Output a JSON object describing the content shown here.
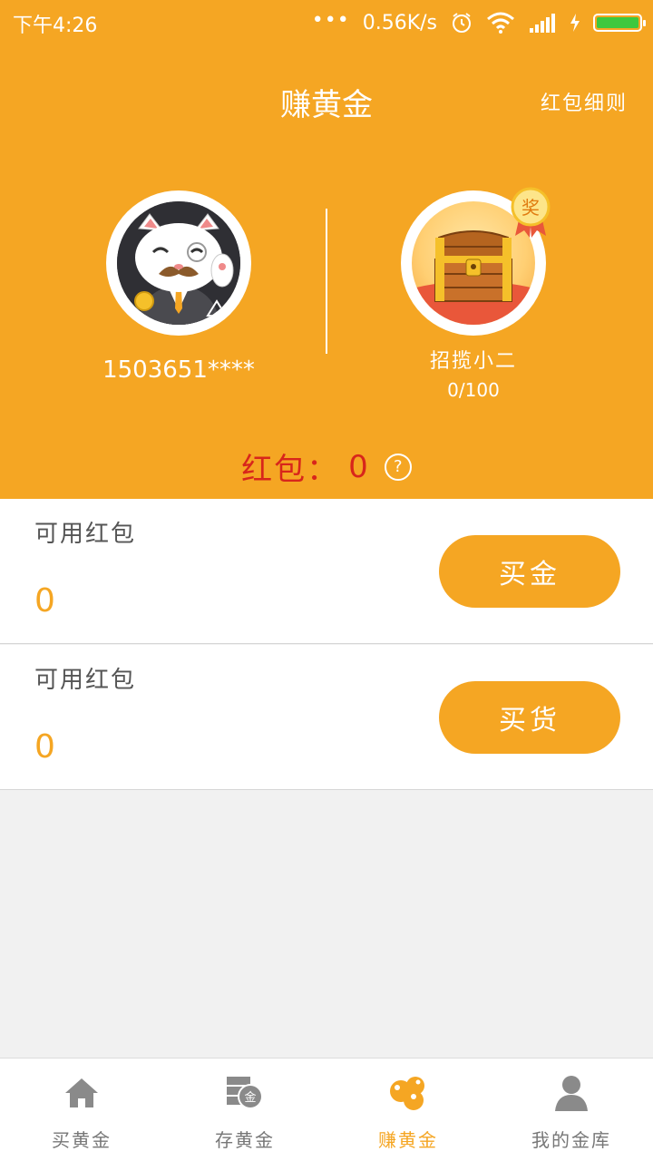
{
  "status_bar": {
    "time": "下午4:26",
    "network_speed": "0.56K/s",
    "icons": [
      "more-dots-icon",
      "alarm-icon",
      "wifi-icon",
      "signal-icon",
      "charging-icon",
      "battery-icon"
    ]
  },
  "header": {
    "title": "赚黄金",
    "rules_link": "红包细则"
  },
  "user": {
    "phone": "1503651****",
    "avatar_icon": "lucky-cat-avatar"
  },
  "rank": {
    "title": "招揽小二",
    "progress": "0/100",
    "badge": "奖",
    "avatar_icon": "treasure-chest-avatar"
  },
  "red_packet": {
    "label": "红包：",
    "value": "0",
    "help": "?"
  },
  "rows": [
    {
      "label": "可用红包",
      "value": "0",
      "button": "买金"
    },
    {
      "label": "可用红包",
      "value": "0",
      "button": "买货"
    }
  ],
  "nav": [
    {
      "label": "买黄金",
      "icon": "home-icon",
      "active": false
    },
    {
      "label": "存黄金",
      "icon": "gold-storage-icon",
      "icon_text": "金",
      "active": false
    },
    {
      "label": "赚黄金",
      "icon": "coins-icon",
      "active": true
    },
    {
      "label": "我的金库",
      "icon": "user-icon",
      "active": false
    }
  ],
  "colors": {
    "brand": "#f5a623",
    "red": "#d8261b",
    "background": "#f1f1f1"
  }
}
